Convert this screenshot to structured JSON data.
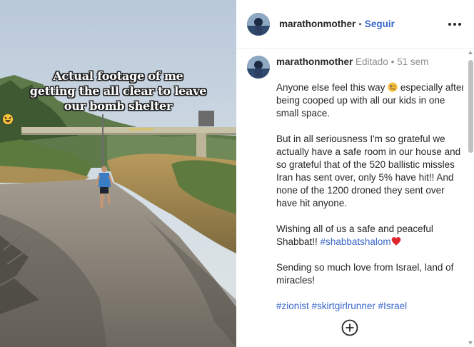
{
  "post": {
    "overlay_lines": [
      "Actual footage of me",
      "getting the all clear to leave",
      "our bomb shelter"
    ],
    "overlay_emoji": "laughing-face"
  },
  "header": {
    "username": "marathonmother",
    "separator": "•",
    "follow_label": "Seguir"
  },
  "caption": {
    "username": "marathonmother",
    "edited_label": "Editado",
    "separator": "•",
    "time": "51 sem",
    "paragraphs": {
      "p1_text": "Anyone else feel this way",
      "p1_emoji": "woozy-face",
      "p1_rest": " especially after being cooped up with all our kids in one small space.",
      "p2": "But in all seriousness I'm so grateful we actually have a safe room in our house and so grateful that of the 520 ballistic missles Iran has sent over, only 5% have hit!! And none of the 1200 droned they sent over have hit anyone.",
      "p3_text": "Wishing all of us a safe and peaceful Shabbat!! ",
      "p3_tag": "#shabbatshalom",
      "p3_emoji": "red-heart",
      "p4": "Sending so much love from Israel, land of miracles!",
      "hashtags": [
        "#zionist",
        "#skirtgirlrunner",
        "#Israel"
      ]
    }
  },
  "colors": {
    "link": "#3a67c9",
    "muted": "#8e8e8e",
    "text": "#262626"
  },
  "icons": {
    "more": "more-horizontal-icon",
    "add": "add-circle-icon"
  }
}
